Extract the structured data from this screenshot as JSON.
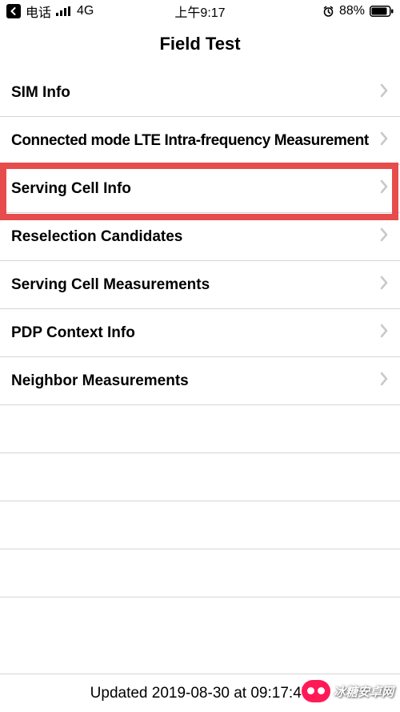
{
  "status": {
    "carrier": "电话",
    "network": "4G",
    "time": "上午9:17",
    "battery_pct": "88%"
  },
  "nav": {
    "title": "Field Test"
  },
  "rows": [
    {
      "label": "SIM Info"
    },
    {
      "label": "Connected mode LTE Intra-frequency Measurement",
      "truncated": true
    },
    {
      "label": "Serving Cell Info",
      "highlighted": true
    },
    {
      "label": "Reselection Candidates"
    },
    {
      "label": "Serving Cell Measurements"
    },
    {
      "label": "PDP Context Info"
    },
    {
      "label": "Neighbor Measurements"
    },
    {
      "label": ""
    },
    {
      "label": ""
    },
    {
      "label": ""
    },
    {
      "label": ""
    }
  ],
  "footer": {
    "updated": "Updated 2019-08-30 at 09:17:47"
  },
  "watermark": {
    "text": "冰糖安卓网"
  },
  "highlight_color": "#e74c4c"
}
